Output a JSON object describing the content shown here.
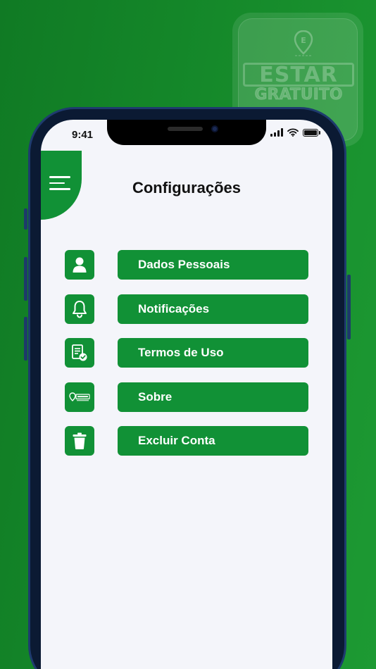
{
  "background": {
    "logo_line1": "ESTAR",
    "logo_line2": "GRATUITO",
    "logo_pin_letter": "E"
  },
  "status_bar": {
    "time": "9:41"
  },
  "header": {
    "title": "Configurações"
  },
  "menu": {
    "items": [
      {
        "label": "Dados Pessoais",
        "icon": "user-icon"
      },
      {
        "label": "Notificações",
        "icon": "bell-icon"
      },
      {
        "label": "Termos de Uso",
        "icon": "document-check-icon"
      },
      {
        "label": "Sobre",
        "icon": "estar-logo-icon"
      },
      {
        "label": "Excluir Conta",
        "icon": "trash-icon"
      }
    ]
  },
  "colors": {
    "accent": "#119136",
    "background": "#f4f5fa",
    "text": "#111111"
  }
}
